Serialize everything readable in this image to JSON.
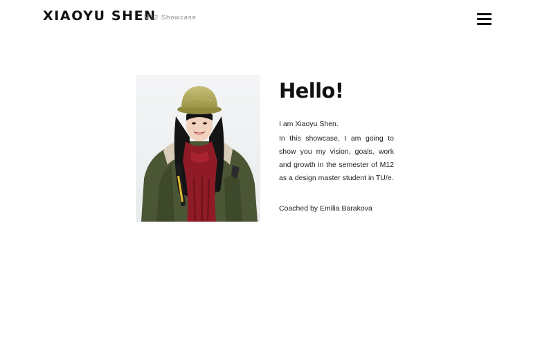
{
  "header": {
    "brand": "XIAOYU SHEN",
    "subtitle": "M12 Showcase",
    "menu_icon": "hamburger-menu-icon"
  },
  "intro": {
    "heading": "Hello!",
    "paragraph_1": "I am Xiaoyu Shen.",
    "paragraph_2": "In this showcase, I am going to show you my vision, goals, work and growth in the semester of M12 as a design master student in TU/e.",
    "coach": "Coached by Emilia Barakova"
  },
  "photo": {
    "depicts": "portrait photo"
  },
  "colors": {
    "text": "#111111",
    "subtitle": "#8a8a8a",
    "background": "#ffffff"
  }
}
